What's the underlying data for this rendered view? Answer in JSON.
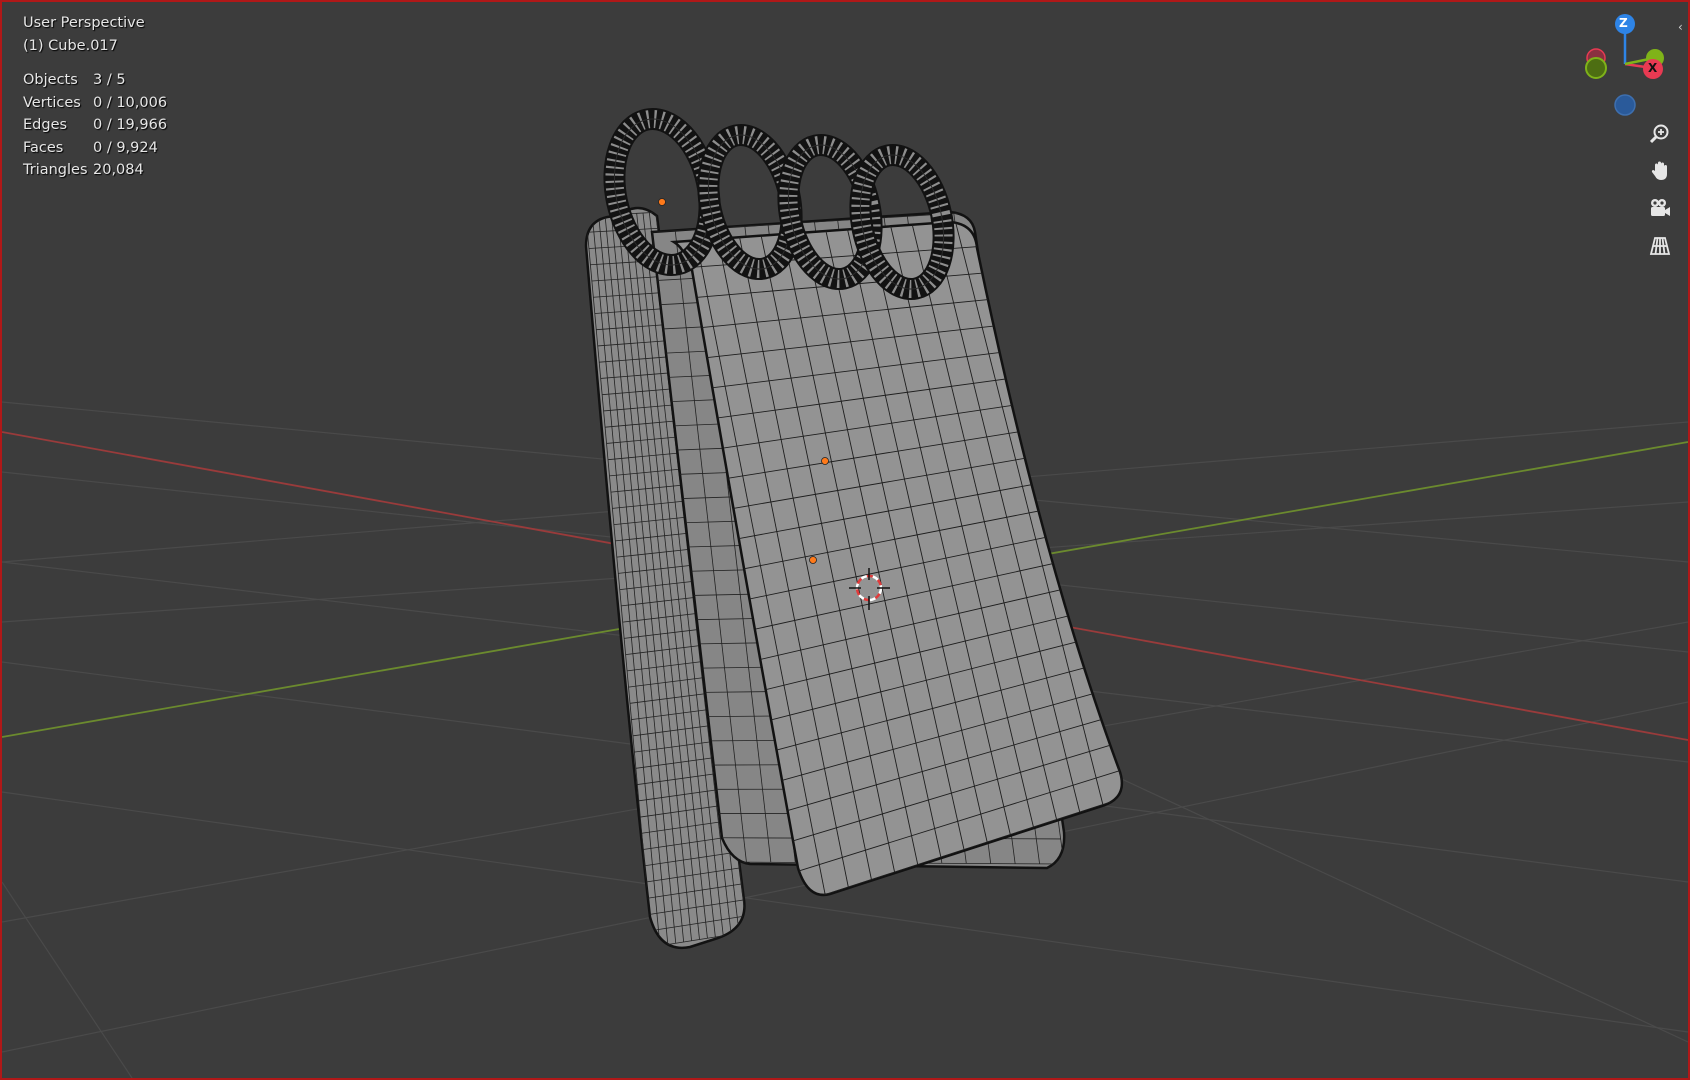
{
  "viewport": {
    "mode_label": "User Perspective",
    "object_label": "(1) Cube.017"
  },
  "stats": [
    {
      "label": "Objects",
      "value": "3 / 5"
    },
    {
      "label": "Vertices",
      "value": "0 / 10,006"
    },
    {
      "label": "Edges",
      "value": "0 / 19,966"
    },
    {
      "label": "Faces",
      "value": "0 / 9,924"
    },
    {
      "label": "Triangles",
      "value": "20,084"
    }
  ],
  "gizmo": {
    "z_label": "Z",
    "x_label": "X",
    "colors": {
      "x": "#e83a52",
      "y": "#7fb319",
      "z": "#2e84e6"
    }
  },
  "nav_tools": [
    "zoom-icon",
    "hand-pan-icon",
    "camera-icon",
    "grid-view-icon"
  ],
  "colors": {
    "background": "#3c3c3c",
    "border": "#b01818",
    "mesh_fill": "#8e8e8e",
    "wire": "#1a1a1a",
    "x_axis": "#9a3b3b",
    "y_axis": "#6b8a2e",
    "origin": "#ff7a1a"
  }
}
